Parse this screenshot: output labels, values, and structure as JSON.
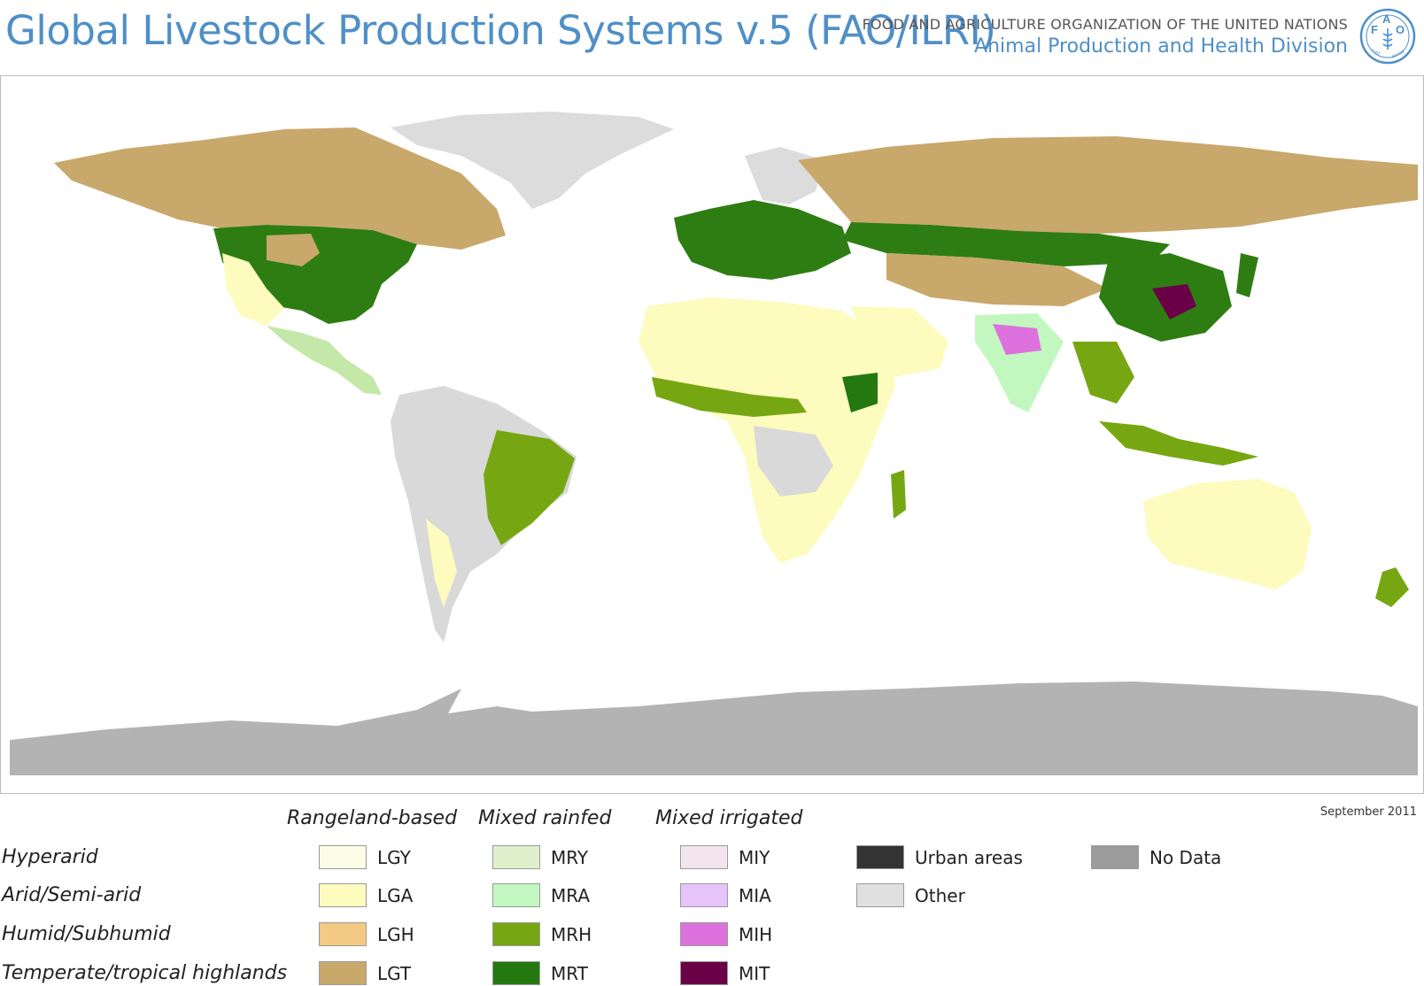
{
  "header": {
    "title": "Global Livestock Production Systems v.5 (FAO/ILRI)",
    "organization": "FOOD AND AGRICULTURE ORGANIZATION OF THE UNITED NATIONS",
    "division": "Animal Production and Health Division",
    "logo_text": "FAO",
    "logo_motto": "FIAT PANIS"
  },
  "map": {
    "icon": "world-map"
  },
  "legend": {
    "date": "September 2011",
    "columns": [
      "Rangeland-based",
      "Mixed rainfed",
      "Mixed irrigated"
    ],
    "rows": [
      "Hyperarid",
      "Arid/Semi-arid",
      "Humid/Subhumid",
      "Temperate/tropical highlands"
    ],
    "classes": [
      {
        "code": "LGY",
        "color": "#fbfde6"
      },
      {
        "code": "LGA",
        "color": "#fdfbbd"
      },
      {
        "code": "LGH",
        "color": "#f3c983"
      },
      {
        "code": "LGT",
        "color": "#c9a86c"
      },
      {
        "code": "MRY",
        "color": "#dff1cc"
      },
      {
        "code": "MRA",
        "color": "#c3f7c0"
      },
      {
        "code": "MRH",
        "color": "#76a712"
      },
      {
        "code": "MRT",
        "color": "#237810"
      },
      {
        "code": "MIY",
        "color": "#f3e4ee"
      },
      {
        "code": "MIA",
        "color": "#e6c3f9"
      },
      {
        "code": "MIH",
        "color": "#dd71de"
      },
      {
        "code": "MIT",
        "color": "#6a0046"
      }
    ],
    "other_classes": [
      {
        "label": "Urban areas",
        "color": "#333333"
      },
      {
        "label": "Other",
        "color": "#e0e0e0"
      },
      {
        "label": "No Data",
        "color": "#9b9b9b"
      }
    ]
  }
}
